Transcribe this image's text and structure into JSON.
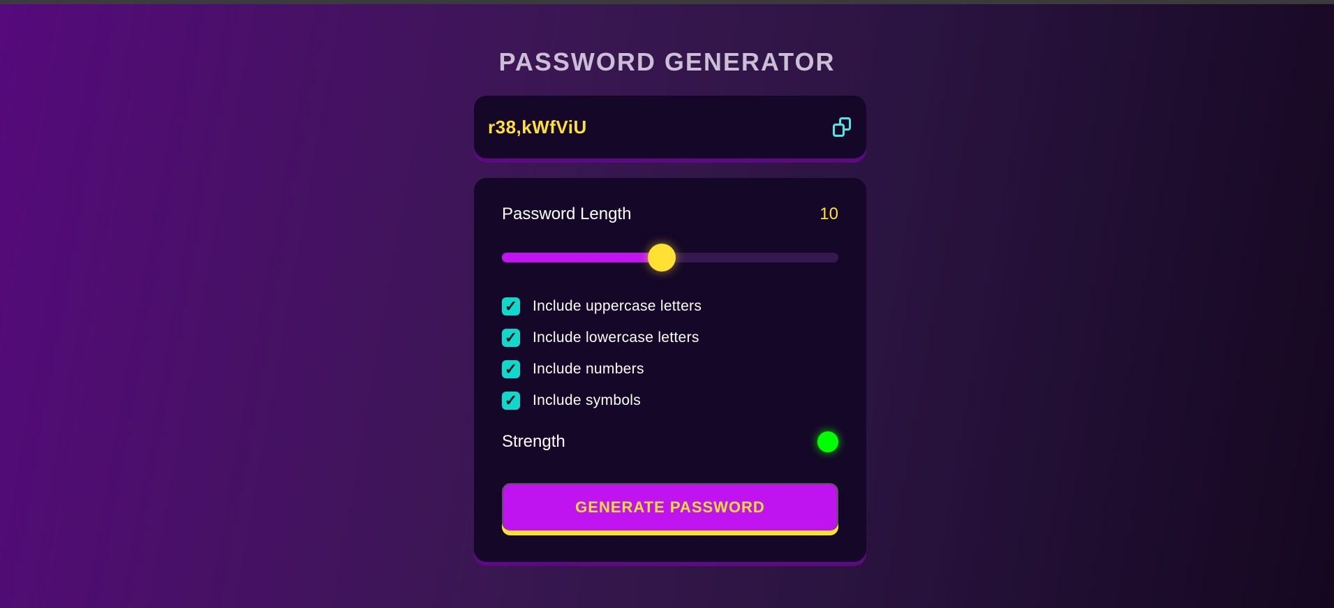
{
  "title": "PASSWORD GENERATOR",
  "password": "r38,kWfViU",
  "length": {
    "label": "Password Length",
    "value": "10",
    "min": 1,
    "max": 20,
    "fraction": 0.475
  },
  "options": [
    {
      "label": "Include uppercase letters",
      "checked": true
    },
    {
      "label": "Include lowercase letters",
      "checked": true
    },
    {
      "label": "Include numbers",
      "checked": true
    },
    {
      "label": "Include symbols",
      "checked": true
    }
  ],
  "check_glyph": "✓",
  "strength": {
    "label": "Strength",
    "color": "#00ff00"
  },
  "generate_label": "GENERATE PASSWORD",
  "colors": {
    "accent": "#bf14f0",
    "yellow": "#ffe033",
    "teal": "#11d8cc"
  }
}
